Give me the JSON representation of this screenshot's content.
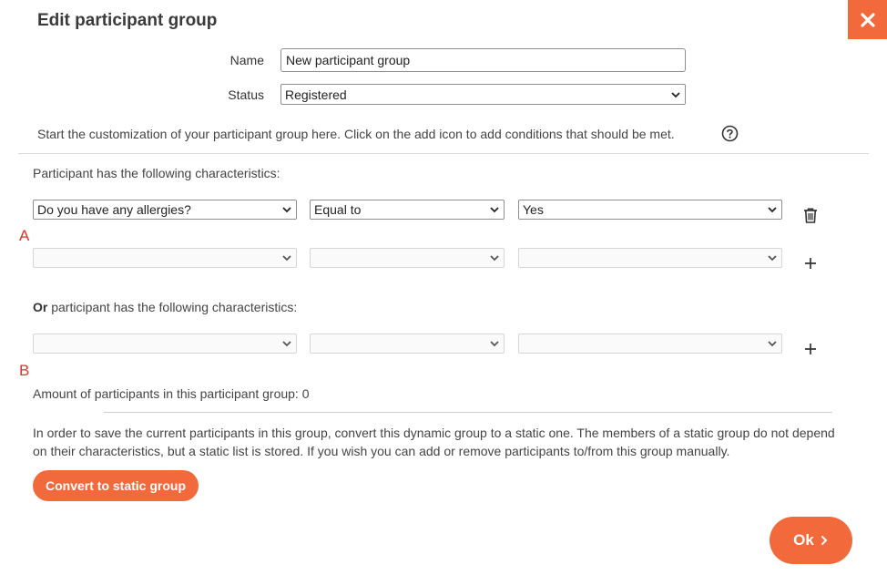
{
  "dialog": {
    "title": "Edit participant group"
  },
  "form": {
    "name_label": "Name",
    "name_value": "New participant group",
    "status_label": "Status",
    "status_value": "Registered"
  },
  "intro_text": "Start the customization of your participant group here. Click on the add icon to add conditions that should be met.",
  "group_a": {
    "marker": "A",
    "heading": "Participant has the following characteristics:",
    "condition": {
      "question": "Do you have any allergies?",
      "operator": "Equal to",
      "value": "Yes"
    },
    "empty_row": {
      "question": "",
      "operator": "",
      "value": ""
    }
  },
  "group_b": {
    "marker": "B",
    "heading_bold": "Or",
    "heading_rest": " participant has the following characteristics:",
    "empty_row": {
      "question": "",
      "operator": "",
      "value": ""
    }
  },
  "participant_count_text": "Amount of participants in this participant group: 0",
  "static_info_text": "In order to save the current participants in this group, convert this dynamic group to a static one. The members of a static group do not depend on their characteristics, but a static list is stored. If you wish you can add or remove participants to/from this group manually.",
  "buttons": {
    "convert": "Convert to static group",
    "ok": "Ok"
  },
  "icons": {
    "close": "close-icon",
    "help": "help-circle-icon",
    "delete": "trash-icon",
    "add": "plus-icon",
    "chevron": "chevron-down-icon",
    "ok_arrow": "chevron-right-icon"
  },
  "colors": {
    "accent": "#f26a3c",
    "marker": "#e0332a"
  }
}
